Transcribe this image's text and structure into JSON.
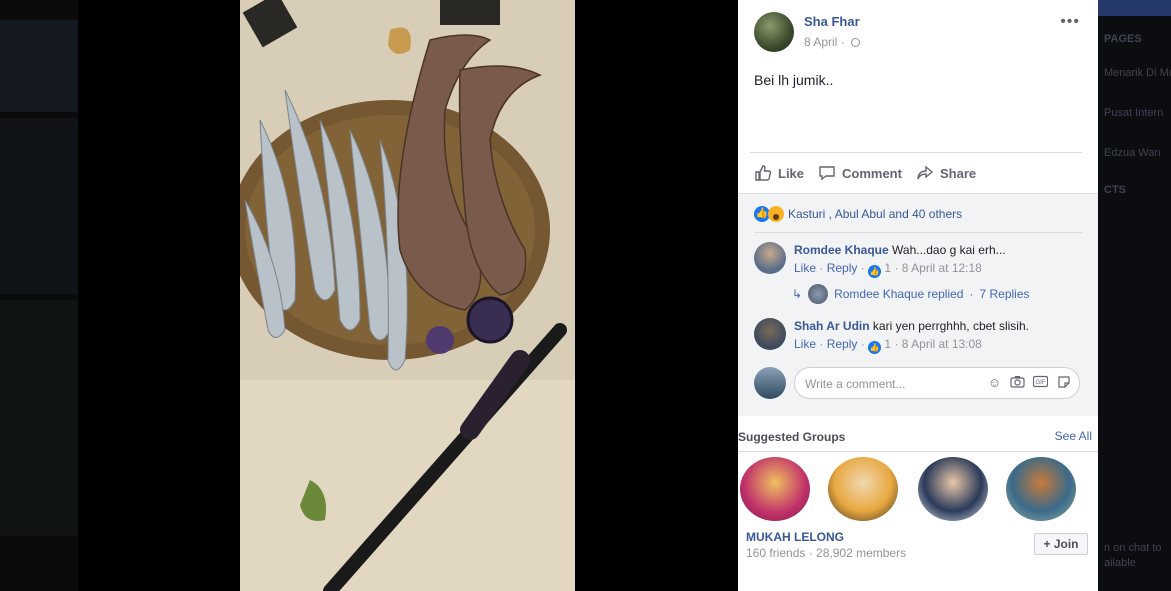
{
  "background_right": {
    "section_pages": "PAGES",
    "items": [
      "Menarik Di Mu",
      "Pusat Intern",
      "Edzua Wan"
    ],
    "section_contacts": "CTS",
    "chat_note": "n on chat to",
    "chat_note2": "ailable"
  },
  "post": {
    "author": "Sha Fhar",
    "date": "8 April",
    "menu_icon": "more-dots-icon",
    "text": "Bei lh jumik..",
    "actions": {
      "like": "Like",
      "comment": "Comment",
      "share": "Share"
    }
  },
  "reactions": {
    "summary": "Kasturi , Abul Abul and 40 others"
  },
  "comments": [
    {
      "name": "Romdee Khaque",
      "text": "Wah...dao g kai erh...",
      "like": "Like",
      "reply": "Reply",
      "likes": "1",
      "time": "8 April at 12:18",
      "avatar_color": "#5a6e8a"
    },
    {
      "name": "Shah Ar Udin",
      "text": "kari yen perrghhh, cbet slisih.",
      "like": "Like",
      "reply": "Reply",
      "likes": "1",
      "time": "8 April at 13:08",
      "avatar_color": "#3d4a5c"
    }
  ],
  "replies_row": {
    "label": "Romdee Khaque replied",
    "count": "7 Replies"
  },
  "write_comment": {
    "placeholder": "Write a comment..."
  },
  "suggested_groups": {
    "title": "Suggested Groups",
    "see_all": "See All",
    "group_name": "MUKAH LELONG",
    "group_meta": "160 friends · 28,902 members",
    "join": "Join"
  }
}
